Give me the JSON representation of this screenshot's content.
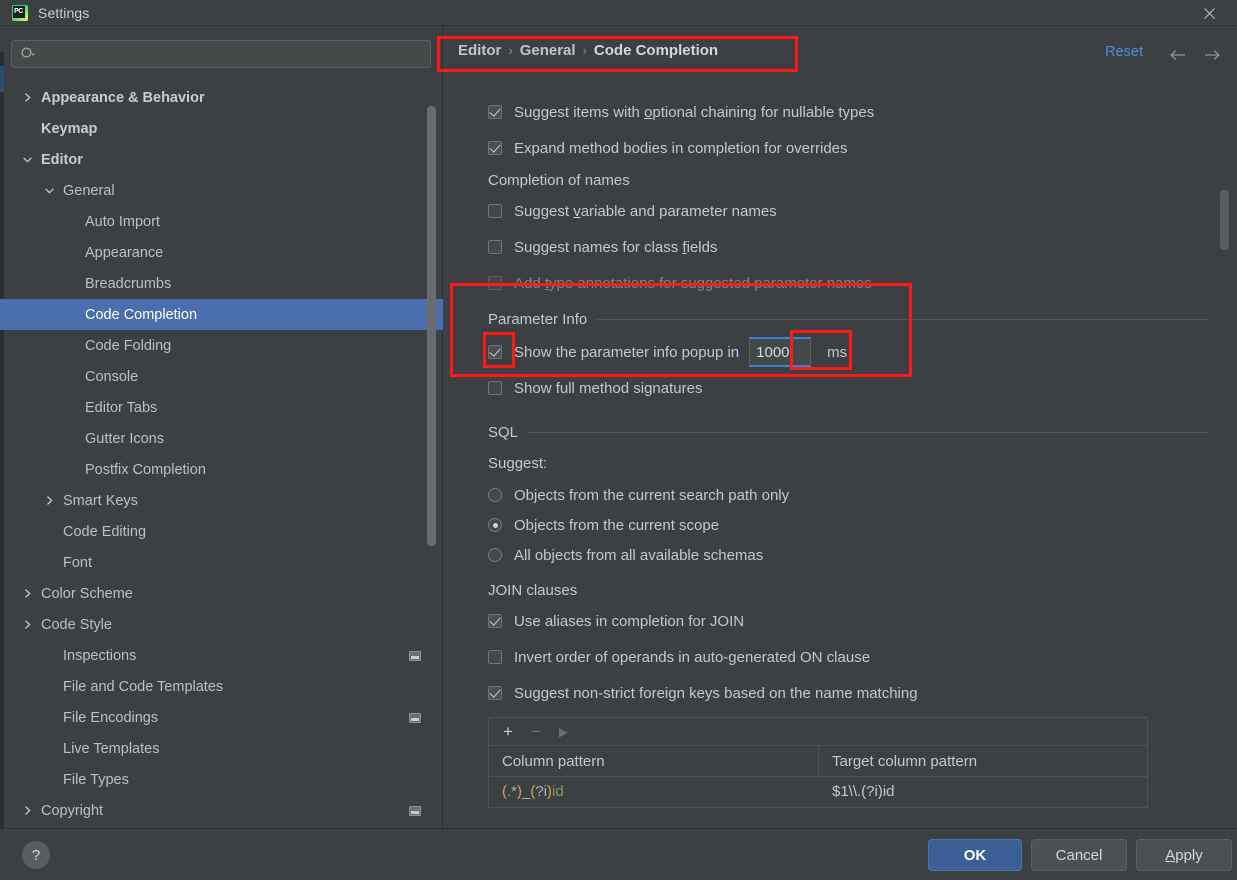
{
  "window": {
    "title": "Settings",
    "app_icon": "pycharm-icon",
    "close_icon": "close-icon"
  },
  "sidebar": {
    "search": {
      "placeholder": "",
      "value": "",
      "icon": "search-icon"
    },
    "items": [
      {
        "label": "Appearance & Behavior",
        "indent": 0,
        "arrow": "right",
        "bold": true,
        "selected": false,
        "badge": false
      },
      {
        "label": "Keymap",
        "indent": 0,
        "arrow": "none",
        "bold": true,
        "selected": false,
        "badge": false
      },
      {
        "label": "Editor",
        "indent": 0,
        "arrow": "down",
        "bold": true,
        "selected": false,
        "badge": false
      },
      {
        "label": "General",
        "indent": 1,
        "arrow": "down",
        "bold": false,
        "selected": false,
        "badge": false
      },
      {
        "label": "Auto Import",
        "indent": 2,
        "arrow": "none",
        "bold": false,
        "selected": false,
        "badge": false
      },
      {
        "label": "Appearance",
        "indent": 2,
        "arrow": "none",
        "bold": false,
        "selected": false,
        "badge": false
      },
      {
        "label": "Breadcrumbs",
        "indent": 2,
        "arrow": "none",
        "bold": false,
        "selected": false,
        "badge": false
      },
      {
        "label": "Code Completion",
        "indent": 2,
        "arrow": "none",
        "bold": false,
        "selected": true,
        "badge": false
      },
      {
        "label": "Code Folding",
        "indent": 2,
        "arrow": "none",
        "bold": false,
        "selected": false,
        "badge": false
      },
      {
        "label": "Console",
        "indent": 2,
        "arrow": "none",
        "bold": false,
        "selected": false,
        "badge": false
      },
      {
        "label": "Editor Tabs",
        "indent": 2,
        "arrow": "none",
        "bold": false,
        "selected": false,
        "badge": false
      },
      {
        "label": "Gutter Icons",
        "indent": 2,
        "arrow": "none",
        "bold": false,
        "selected": false,
        "badge": false
      },
      {
        "label": "Postfix Completion",
        "indent": 2,
        "arrow": "none",
        "bold": false,
        "selected": false,
        "badge": false
      },
      {
        "label": "Smart Keys",
        "indent": 1,
        "arrow": "right",
        "bold": false,
        "selected": false,
        "badge": false
      },
      {
        "label": "Code Editing",
        "indent": 1,
        "arrow": "none",
        "bold": false,
        "selected": false,
        "badge": false
      },
      {
        "label": "Font",
        "indent": 1,
        "arrow": "none",
        "bold": false,
        "selected": false,
        "badge": false
      },
      {
        "label": "Color Scheme",
        "indent": 0,
        "arrow": "right",
        "bold": false,
        "selected": false,
        "badge": false
      },
      {
        "label": "Code Style",
        "indent": 0,
        "arrow": "right",
        "bold": false,
        "selected": false,
        "badge": false
      },
      {
        "label": "Inspections",
        "indent": 1,
        "arrow": "none",
        "bold": false,
        "selected": false,
        "badge": true
      },
      {
        "label": "File and Code Templates",
        "indent": 1,
        "arrow": "none",
        "bold": false,
        "selected": false,
        "badge": false
      },
      {
        "label": "File Encodings",
        "indent": 1,
        "arrow": "none",
        "bold": false,
        "selected": false,
        "badge": true
      },
      {
        "label": "Live Templates",
        "indent": 1,
        "arrow": "none",
        "bold": false,
        "selected": false,
        "badge": false
      },
      {
        "label": "File Types",
        "indent": 1,
        "arrow": "none",
        "bold": false,
        "selected": false,
        "badge": false
      },
      {
        "label": "Copyright",
        "indent": 0,
        "arrow": "right",
        "bold": false,
        "selected": false,
        "badge": true
      }
    ]
  },
  "header": {
    "breadcrumb": [
      "Editor",
      "General",
      "Code Completion"
    ],
    "separator": "›",
    "reset_label": "Reset",
    "back_icon": "arrow-left-icon",
    "forward_icon": "arrow-right-icon"
  },
  "main": {
    "top_checkboxes": [
      {
        "label": "Suggest items with optional chaining for nullable types",
        "checked": true,
        "disabled": false,
        "mnemonic": "o"
      },
      {
        "label": "Expand method bodies in completion for overrides",
        "checked": true,
        "disabled": false,
        "mnemonic": ""
      }
    ],
    "names_group_title": "Completion of names",
    "names_checkboxes": [
      {
        "label": "Suggest variable and parameter names",
        "checked": false,
        "disabled": false,
        "mnemonic": "v"
      },
      {
        "label": "Suggest names for class fields",
        "checked": false,
        "disabled": false,
        "mnemonic": "f"
      },
      {
        "label": "Add type annotations for suggested parameter names",
        "checked": false,
        "disabled": true,
        "mnemonic": "t"
      }
    ],
    "parameter_info": {
      "section_title": "Parameter Info",
      "popup_checkbox": {
        "label_before": "Show the parameter info popup in",
        "checked": true
      },
      "delay_value": "1000",
      "delay_unit": "ms",
      "full_signatures": {
        "label": "Show full method signatures",
        "checked": false
      }
    },
    "sql": {
      "section_title": "SQL",
      "suggest_label": "Suggest:",
      "radios": [
        {
          "label": "Objects from the current search path only",
          "selected": false
        },
        {
          "label": "Objects from the current scope",
          "selected": true
        },
        {
          "label": "All objects from all available schemas",
          "selected": false
        }
      ],
      "join_title": "JOIN clauses",
      "join_checkboxes": [
        {
          "label": "Use aliases in completion for JOIN",
          "checked": true
        },
        {
          "label": "Invert order of operands in auto-generated ON clause",
          "checked": false
        },
        {
          "label": "Suggest non-strict foreign keys based on the name matching",
          "checked": true
        }
      ],
      "table": {
        "toolbar": {
          "add": "+",
          "remove": "−",
          "run": "▶"
        },
        "columns": [
          "Column pattern",
          "Target column pattern"
        ],
        "rows": [
          {
            "pattern_parts": [
              {
                "t": "(",
                "c": "paren"
              },
              {
                "t": ".*",
                "c": "lit"
              },
              {
                "t": ")",
                "c": "paren"
              },
              {
                "t": "_",
                "c": "lit"
              },
              {
                "t": "(",
                "c": "paren"
              },
              {
                "t": "?i",
                "c": "lit"
              },
              {
                "t": ")",
                "c": "paren"
              },
              {
                "t": "id",
                "c": "id"
              }
            ],
            "target": "$1\\\\.(?i)id"
          }
        ]
      }
    }
  },
  "footer": {
    "help_label": "?",
    "ok_label": "OK",
    "cancel_label": "Cancel",
    "apply_label_underline": "A",
    "apply_label_rest": "pply"
  },
  "colors": {
    "accent_blue": "#4b6eaf",
    "link_blue": "#4b8ee0",
    "annotation_red": "#ff1a1a",
    "focus_blue": "#3f7fd0",
    "background": "#3c4043",
    "regex_paren": "#d9a34a",
    "regex_id": "#7a9e62"
  }
}
